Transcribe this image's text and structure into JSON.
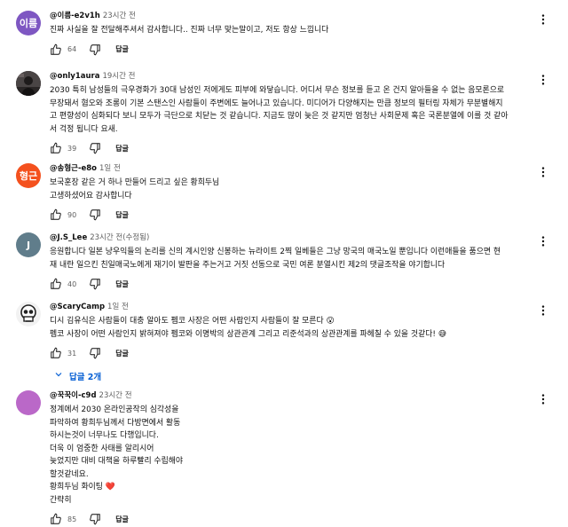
{
  "comments": [
    {
      "author": "@이름-e2v1h",
      "time": "23시간 전",
      "avatar": {
        "type": "initials",
        "text": "이름",
        "color": "#7e57c2"
      },
      "lines": [
        "진짜 사실을 잘 전달해주셔서 감사합니다.. 진짜 너무 맞는말이고, 저도 항상 느낍니다"
      ],
      "likes": "64",
      "reply_label": "답글"
    },
    {
      "author": "@only1aura",
      "time": "19시간 전",
      "avatar": {
        "type": "photo",
        "color": "#3e3a3a"
      },
      "lines": [
        "2030 특히 남성들의 극우경화가 30대 남성인 저에게도 피부에 와닿습니다. 어디서 무슨 정보를 듣고 온 건지 알아들을 수 없는 음모론으로",
        "무장돼서 혐오와 조롱이 기본 스탠스인 사람들이 주변에도 늘어나고 있습니다. 미디어가 다양해지는 만큼 정보의 필터링 자체가 무분별해지",
        "고 편향성이 심화되다 보니 모두가 극단으로 치닫는 것 같습니다. 지금도 많이 늦은 것 같지만 엄청난 사회문제 혹은 국론분열에 이를 것 같아",
        "서 걱정 됩니다 요새."
      ],
      "likes": "39",
      "reply_label": "답글"
    },
    {
      "author": "@송형근-e8o",
      "time": "1일 전",
      "avatar": {
        "type": "initials",
        "text": "형근",
        "color": "#f4511e"
      },
      "lines": [
        "보국훈장 같은 거 하나 만들어 드리고 싶은 황희두님",
        "고생하셨어요 감사합니다"
      ],
      "likes": "90",
      "reply_label": "답글"
    },
    {
      "author": "@J.S_Lee",
      "time": "23시간 전(수정됨)",
      "avatar": {
        "type": "initials",
        "text": "J",
        "color": "#607d8b"
      },
      "lines": [
        "응원합니다 일본 냥우익들의 논리를 신의 계시인양 신봉하는 뉴라이트 2찍 일베들은 그냥 망국의 매국노일 뿐입니다 이런애들을 품으면 현",
        "재 내란 일으킨 친일매국노에게 재기이 발판을 주는거고 거짓 선동으로 국민 여론 분열시킨 제2의 댓글조작을 야기합니다"
      ],
      "likes": "40",
      "reply_label": "답글"
    },
    {
      "author": "@ScaryCamp",
      "time": "1일 전",
      "avatar": {
        "type": "skull",
        "color": "#ffffff"
      },
      "lines": [
        "디시 김유식은 사람들이 대충 알아도 펨코 사장은 어떤 사람인지 사람들이 잘 모른다 😮",
        "펨코 사장이 어떤 사람인지 밝혀져야 펨코와 이명박의 상관관계 그리고 리준석과의 상관관계를 파헤칠 수 있을 것같다! 😅"
      ],
      "likes": "31",
      "reply_label": "답글",
      "replies_label": "답글 2개"
    },
    {
      "author": "@꾹꾹이-c9d",
      "time": "23시간 전",
      "avatar": {
        "type": "initials",
        "text": "",
        "color": "#ba68c8"
      },
      "lines": [
        "정계에서 2030 온라인공작의 심각성을",
        "파악하여 황희두님께서 다방면에서 활동",
        "하시는것이 너무나도 다행입니다.",
        "더욱 이 엄중한 사태를 알리시어",
        "늦었지만 대비 대책을 하루빨리 수립해야",
        "할것같네요.",
        "황희두님 화이팅 ❤️",
        "간략히"
      ],
      "likes": "85",
      "reply_label": "답글"
    }
  ],
  "icons": {
    "like": "thumbs-up-icon",
    "dislike": "thumbs-down-icon",
    "more": "more-vert-icon",
    "replies": "chevron-down-icon"
  },
  "colors": {
    "link_blue": "#065fd4",
    "meta_gray": "#606060",
    "text": "#0f0f0f"
  }
}
